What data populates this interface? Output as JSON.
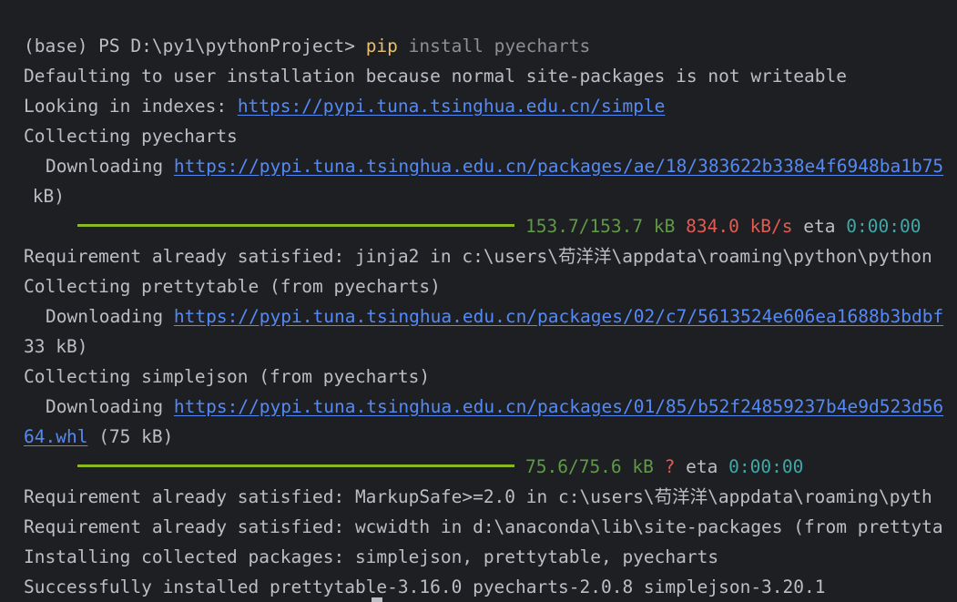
{
  "lines": {
    "l1": {
      "prompt": "(base) PS D:\\py1\\pythonProject> ",
      "cmd": "pip",
      "args": " install pyecharts"
    },
    "l2": "Defaulting to user installation because normal site-packages is not writeable",
    "l3": {
      "text": "Looking in indexes: ",
      "link": "https://pypi.tuna.tsinghua.edu.cn/simple"
    },
    "l4": "Collecting pyecharts",
    "l5": {
      "text": "Downloading ",
      "link": "https://pypi.tuna.tsinghua.edu.cn/packages/ae/18/383622b338e4f6948ba1b75"
    },
    "l6": " kB)",
    "p1": {
      "progress": 1.0,
      "size": "153.7/153.7 kB",
      "speed": "834.0 kB/s",
      "eta_label": "eta",
      "eta": "0:00:00"
    },
    "l8": "Requirement already satisfied: jinja2 in c:\\users\\苟洋洋\\appdata\\roaming\\python\\python",
    "l9": "Collecting prettytable (from pyecharts)",
    "l10": {
      "text": "Downloading ",
      "link": "https://pypi.tuna.tsinghua.edu.cn/packages/02/c7/5613524e606ea1688b3bdbf"
    },
    "l11": "33 kB)",
    "l12": "Collecting simplejson (from pyecharts)",
    "l13": {
      "text": "Downloading ",
      "link": "https://pypi.tuna.tsinghua.edu.cn/packages/01/85/b52f24859237b4e9d523d56"
    },
    "l14": {
      "link": "64.whl",
      "text": " (75 kB)"
    },
    "p2": {
      "progress": 1.0,
      "size": "75.6/75.6 kB",
      "speed": "?",
      "eta_label": "eta",
      "eta": "0:00:00"
    },
    "l16": "Requirement already satisfied: MarkupSafe>=2.0 in c:\\users\\苟洋洋\\appdata\\roaming\\pyth",
    "l17": "Requirement already satisfied: wcwidth in d:\\anaconda\\lib\\site-packages (from prettyta",
    "l18": "Installing collected packages: simplejson, prettytable, pyecharts",
    "l19": "Successfully installed prettytable-3.16.0 pyecharts-2.0.8 simplejson-3.20.1"
  }
}
